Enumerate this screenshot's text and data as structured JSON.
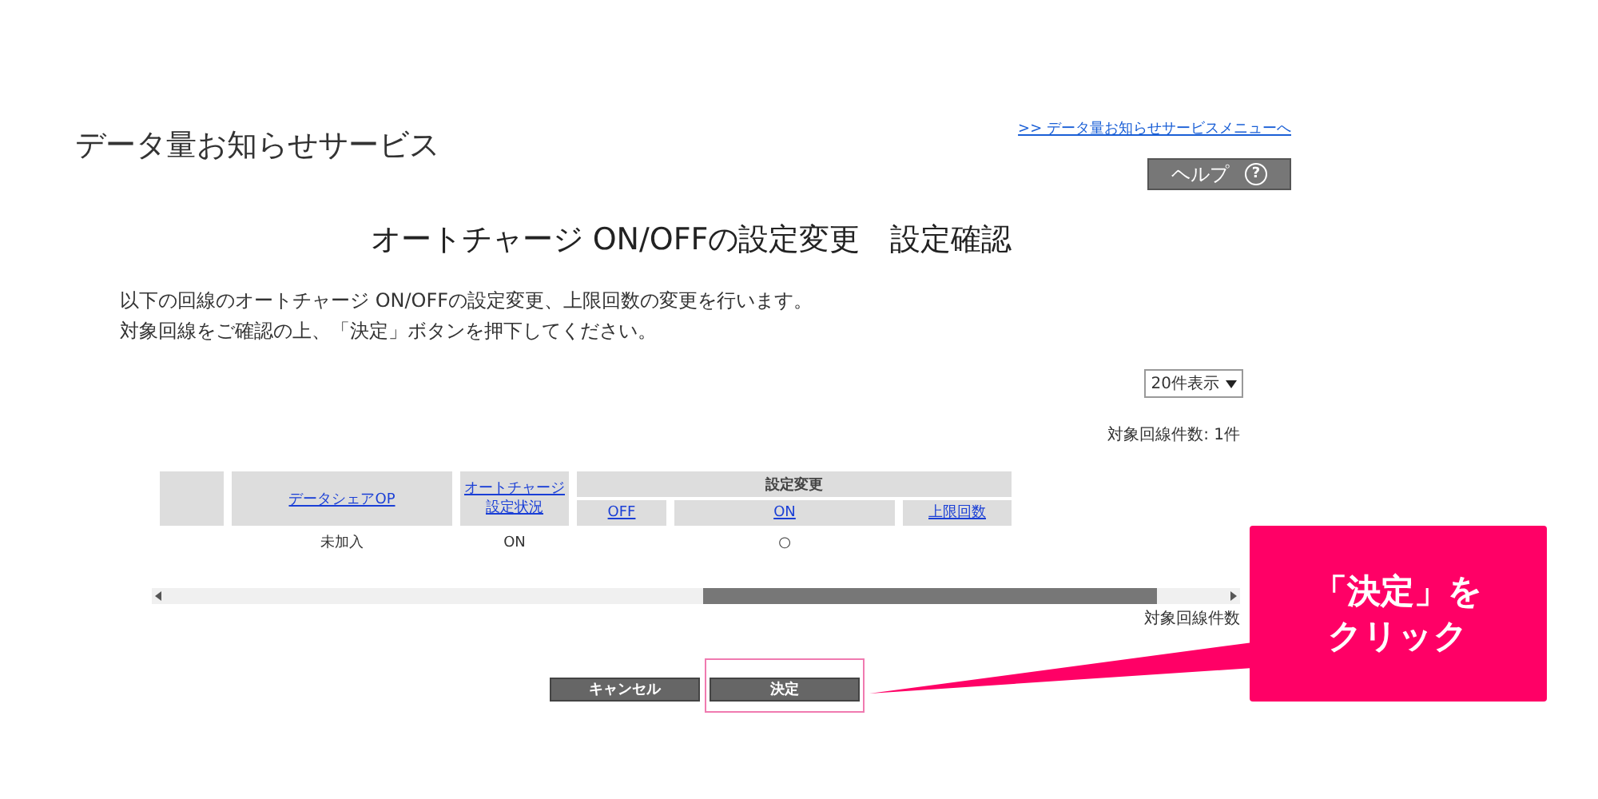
{
  "page_title": "データ量お知らせサービス",
  "menu_link": ">> データ量お知らせサービスメニューへ",
  "help_button": {
    "label": "ヘルプ",
    "icon": "?"
  },
  "heading": "オートチャージ ON/OFFの設定変更　設定確認",
  "description": [
    "以下の回線のオートチャージ ON/OFFの設定変更、上限回数の変更を行います。",
    "対象回線をご確認の上、「決定」ボタンを押下してください。"
  ],
  "page_size_select": {
    "value": "20件表示"
  },
  "count_top": "対象回線件数: 1件",
  "table": {
    "columns": [
      {
        "label": [
          "データシェアOP"
        ]
      },
      {
        "label": [
          "オートチャージ",
          "設定状況"
        ]
      }
    ],
    "group": {
      "label": "設定変更",
      "columns": [
        "OFF",
        "ON",
        "上限回数"
      ]
    },
    "rows": [
      {
        "cells": [
          "未加入",
          "ON",
          "",
          "○",
          ""
        ]
      }
    ]
  },
  "count_bottom": "対象回線件数",
  "buttons": [
    {
      "label": "キャンセル",
      "highlighted": false
    },
    {
      "label": "決定",
      "highlighted": true
    }
  ],
  "annotation": {
    "lines": [
      "「決定」を",
      "クリック"
    ]
  }
}
